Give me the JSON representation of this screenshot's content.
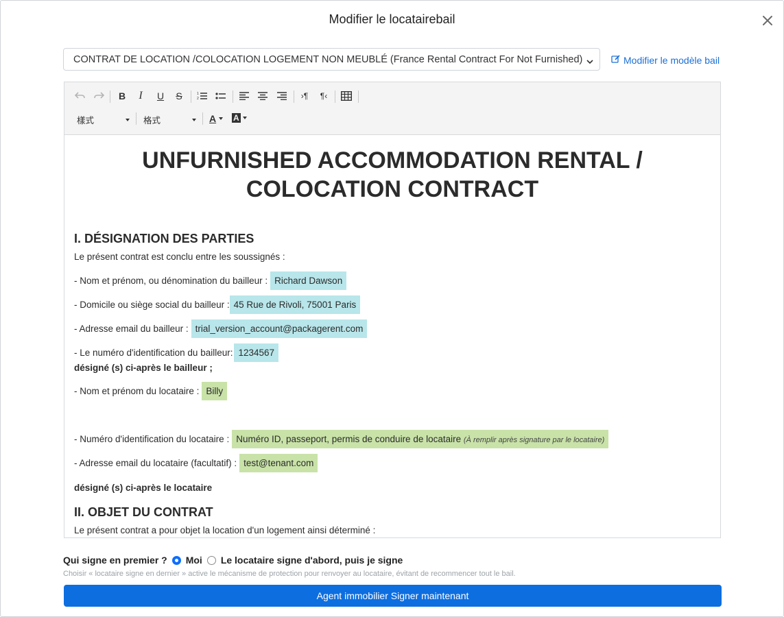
{
  "modal": {
    "title": "Modifier le locatairebail",
    "close_icon": "close-icon"
  },
  "template_select": {
    "selected": "CONTRAT DE LOCATION /COLOCATION LOGEMENT NON MEUBLÉ (France Rental Contract For Not Furnished)"
  },
  "edit_link": {
    "label": "Modifier le modèle bail",
    "icon": "edit-square-icon"
  },
  "toolbar": {
    "buttons": [
      {
        "name": "undo",
        "glyph": "↶"
      },
      {
        "name": "redo",
        "glyph": "↷"
      },
      {
        "name": "bold",
        "glyph": "B"
      },
      {
        "name": "italic",
        "glyph": "I"
      },
      {
        "name": "underline",
        "glyph": "U"
      },
      {
        "name": "strikethrough",
        "glyph": "S"
      },
      {
        "name": "numbered-list",
        "glyph": "1≡"
      },
      {
        "name": "bullet-list",
        "glyph": "•≡"
      },
      {
        "name": "align-left",
        "glyph": "≡"
      },
      {
        "name": "align-center",
        "glyph": "≡"
      },
      {
        "name": "align-right",
        "glyph": "≡"
      },
      {
        "name": "ltr",
        "glyph": "›¶"
      },
      {
        "name": "rtl",
        "glyph": "¶‹"
      },
      {
        "name": "table",
        "glyph": "▦"
      }
    ],
    "style_dropdown": "樣式",
    "format_dropdown": "格式",
    "text_color": "A",
    "bg_color": "A"
  },
  "document": {
    "title_line1": "UNFURNISHED ACCOMMODATION RENTAL /",
    "title_line2": "COLOCATION CONTRACT",
    "section1": "I. DÉSIGNATION DES PARTIES",
    "intro": "Le présent contrat est conclu entre les soussignés :",
    "landlord_name_label": "- Nom et prénom, ou dénomination du bailleur :",
    "landlord_name": "Richard Dawson",
    "landlord_address_label": "- Domicile ou siège social du bailleur :",
    "landlord_address": "45 Rue de Rivoli, 75001 Paris",
    "landlord_email_label": "- Adresse email du bailleur :",
    "landlord_email": "trial_version_account@packagerent.com",
    "landlord_id_label": "- Le numéro d'identification du bailleur:",
    "landlord_id": "1234567",
    "landlord_designated": "désigné (s) ci-après le bailleur ;",
    "tenant_name_label": "- Nom et prénom du locataire :",
    "tenant_name": "Billy",
    "tenant_id_label": "- Numéro d'identification du locataire :",
    "tenant_id": "Numéro ID, passeport, permis de conduire de locataire",
    "tenant_id_note": "(À remplir après signature par le locataire)",
    "tenant_email_label": "- Adresse email du locataire (facultatif) :",
    "tenant_email": "test@tenant.com",
    "tenant_designated": "désigné (s) ci-après le locataire",
    "section2": "II. OBJET DU CONTRAT",
    "object_intro": "Le présent contrat a pour objet la location d'un logement ainsi déterminé :"
  },
  "signing": {
    "question": "Qui signe en premier ?",
    "option_me": "Moi",
    "option_tenant": "Le locataire signe d'abord, puis je signe",
    "selected": "Moi",
    "hint": "Choisir « locataire signe en dernier » active le mécanisme de protection pour renvoyer au locataire, évitant de recommencer tout le bail.",
    "button": "Agent immobilier Signer maintenant"
  },
  "colors": {
    "primary": "#0d6ee0",
    "highlight_landlord": "#b8e6ea",
    "highlight_tenant": "#c8e2a8",
    "link": "#1a6fd6"
  }
}
